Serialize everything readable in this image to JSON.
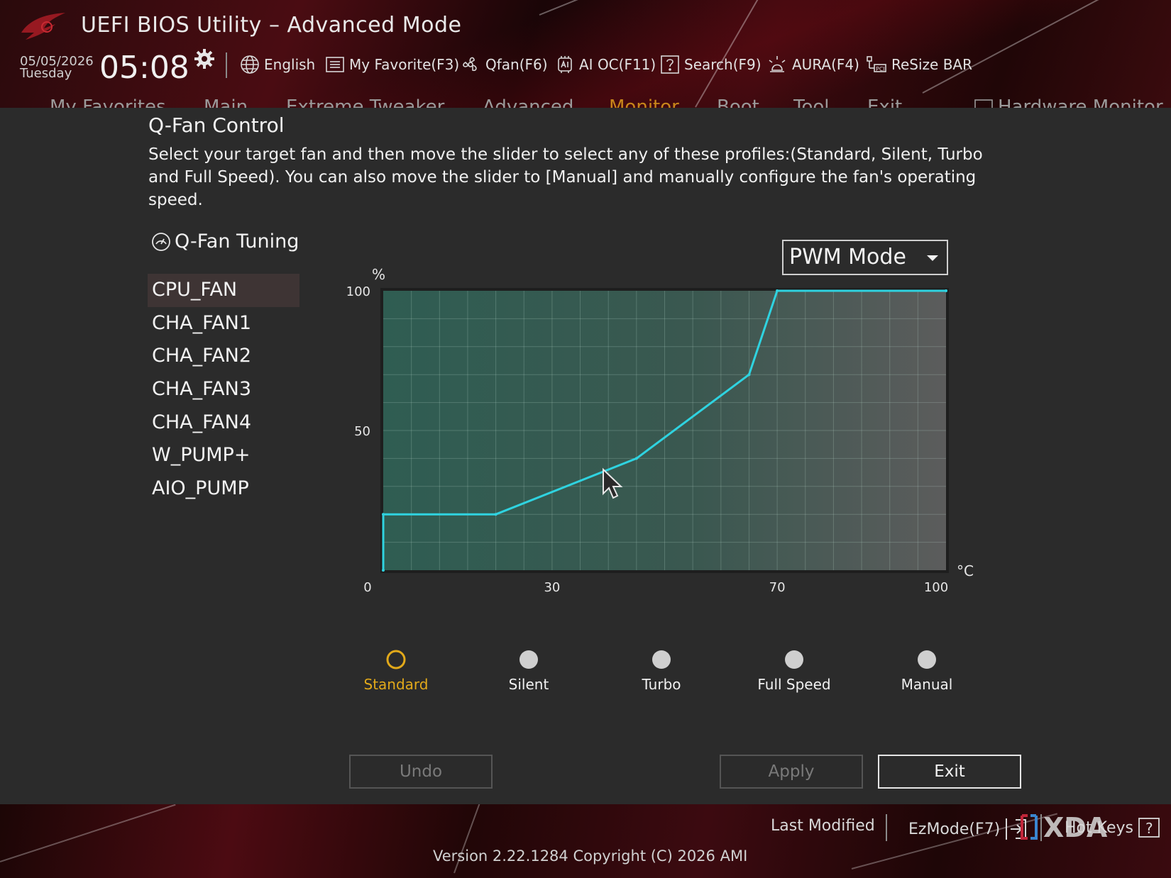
{
  "header": {
    "title": "UEFI BIOS Utility – Advanced Mode",
    "date": "05/05/2026",
    "weekday": "Tuesday",
    "time": "05:08",
    "toolbar": [
      {
        "label": "English",
        "icon": "globe-icon"
      },
      {
        "label": "My Favorite(F3)",
        "icon": "favorite-list-icon"
      },
      {
        "label": "Qfan(F6)",
        "icon": "fan-icon"
      },
      {
        "label": "AI OC(F11)",
        "icon": "ai-oc-icon"
      },
      {
        "label": "Search(F9)",
        "icon": "search-help-icon"
      },
      {
        "label": "AURA(F4)",
        "icon": "aura-light-icon"
      },
      {
        "label": "ReSize BAR",
        "icon": "resize-bar-icon"
      }
    ]
  },
  "tabs": [
    "My Favorites",
    "Main",
    "Extreme Tweaker",
    "Advanced",
    "Monitor",
    "Boot",
    "Tool",
    "Exit"
  ],
  "active_tab": "Monitor",
  "hardware_monitor_label": "Hardware Monitor",
  "dialog": {
    "title": "Q-Fan Control",
    "description": "Select your target fan and then move the slider to select any of these profiles:(Standard, Silent, Turbo and Full Speed). You can also move the slider to [Manual] and manually configure the fan's operating speed.",
    "tuning_label": "Q-Fan Tuning",
    "fans": [
      "CPU_FAN",
      "CHA_FAN1",
      "CHA_FAN2",
      "CHA_FAN3",
      "CHA_FAN4",
      "W_PUMP+",
      "AIO_PUMP"
    ],
    "selected_fan": "CPU_FAN",
    "mode": "PWM Mode",
    "profiles": [
      "Standard",
      "Silent",
      "Turbo",
      "Full Speed",
      "Manual"
    ],
    "selected_profile": "Standard",
    "buttons": {
      "undo": "Undo",
      "apply": "Apply",
      "exit": "Exit"
    }
  },
  "chart_data": {
    "type": "line",
    "xlabel": "°C",
    "ylabel": "%",
    "xlim": [
      0,
      100
    ],
    "ylim": [
      0,
      100
    ],
    "x_ticks": [
      "0",
      "30",
      "70",
      "100"
    ],
    "y_ticks": [
      "100",
      "50"
    ],
    "series": [
      {
        "x": [
          0,
          0,
          20,
          45,
          65,
          70,
          100
        ],
        "y": [
          0,
          20,
          20,
          40,
          70,
          100,
          100
        ]
      }
    ],
    "line_color": "#2fd3e0",
    "grid": true
  },
  "footer": {
    "last_modified": "Last Modified",
    "ezmode": "EzMode(F7)",
    "hotkeys": "Hot Keys",
    "version": "Version 2.22.1284 Copyright (C) 2026 AMI",
    "watermark": "XDA"
  }
}
